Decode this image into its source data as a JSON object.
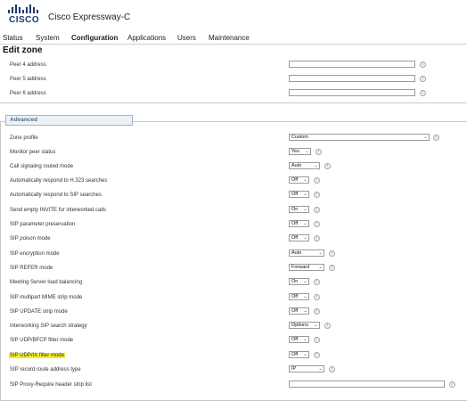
{
  "header": {
    "logo_text": "CISCO",
    "product_name": "Cisco Expressway-C"
  },
  "nav": {
    "items": [
      "Status",
      "System",
      "Configuration",
      "Applications",
      "Users",
      "Maintenance"
    ],
    "active": "Configuration"
  },
  "page": {
    "title": "Edit zone"
  },
  "peers": [
    {
      "label": "Peer 4 address",
      "value": ""
    },
    {
      "label": "Peer 5 address",
      "value": ""
    },
    {
      "label": "Peer 6 address",
      "value": ""
    }
  ],
  "advanced": {
    "title": "Advanced",
    "rows": [
      {
        "label": "Zone profile",
        "value": "Custom"
      },
      {
        "label": "Monitor peer status",
        "value": "Yes"
      },
      {
        "label": "Call signaling routed mode",
        "value": "Auto"
      },
      {
        "label": "Automatically respond to H.323 searches",
        "value": "Off"
      },
      {
        "label": "Automatically respond to SIP searches",
        "value": "Off"
      },
      {
        "label": "Send empty INVITE for interworked calls",
        "value": "On"
      },
      {
        "label": "SIP parameter preservation",
        "value": "Off"
      },
      {
        "label": "SIP poison mode",
        "value": "Off"
      },
      {
        "label": "SIP encryption mode",
        "value": "Auto"
      },
      {
        "label": "SIP REFER mode",
        "value": "Forward"
      },
      {
        "label": "Meeting Server load balancing",
        "value": "On"
      },
      {
        "label": "SIP multipart MIME strip mode",
        "value": "Off"
      },
      {
        "label": "SIP UPDATE strip mode",
        "value": "Off"
      },
      {
        "label": "Interworking SIP search strategy",
        "value": "Options"
      },
      {
        "label": "SIP UDP/BFCP filter mode",
        "value": "Off"
      },
      {
        "label": "SIP UDP/IX filter mode",
        "value": "Off"
      },
      {
        "label": "SIP record route address type",
        "value": "IP"
      },
      {
        "label": "SIP Proxy-Require header strip list",
        "value": ""
      }
    ]
  },
  "colors": {
    "logo": "#1b3a6b",
    "highlight": "#f2f21a",
    "advanced_tab": "#4a6a8a"
  },
  "icons": {
    "info": "info-icon",
    "dropdown": "chevron-down-icon"
  }
}
